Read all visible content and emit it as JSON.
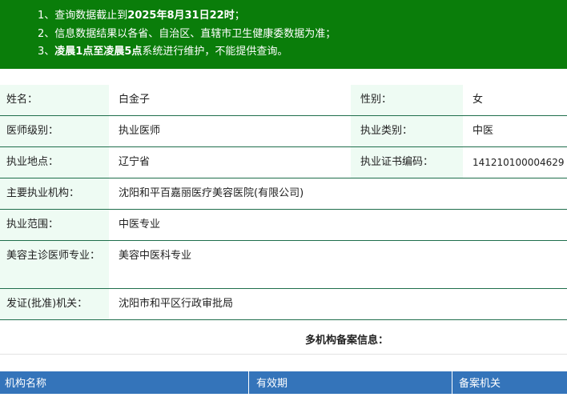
{
  "notice": {
    "line1_prefix": "1、查询数据截止到",
    "line1_bold": "2025年8月31日22时",
    "line1_suffix": "；",
    "line2": "2、信息数据结果以各省、自治区、直辖市卫生健康委数据为准；",
    "line3_prefix": "3、",
    "line3_bold": "凌晨1点至凌晨5点",
    "line3_suffix": "系统进行维护，不能提供查询。",
    "background_color": "#0a7d0a"
  },
  "info": {
    "name_label": "姓名：",
    "name_value": "白金子",
    "gender_label": "性别：",
    "gender_value": "女",
    "level_label": "医师级别：",
    "level_value": "执业医师",
    "category_label": "执业类别：",
    "category_value": "中医",
    "location_label": "执业地点：",
    "location_value": "辽宁省",
    "cert_label": "执业证书编码：",
    "cert_value": "141210100004629",
    "org_label": "主要执业机构：",
    "org_value": "沈阳和平百嘉丽医疗美容医院(有限公司)",
    "scope_label": "执业范围：",
    "scope_value": "中医专业",
    "beauty_label": "美容主诊医师专业：",
    "beauty_value": "美容中医科专业",
    "issuer_label": "发证(批准)机关：",
    "issuer_value": "沈阳市和平区行政审批局"
  },
  "multi_org": {
    "title": "多机构备案信息：",
    "columns": [
      "机构名称",
      "有效期",
      "备案机关"
    ],
    "header_color": "#3474ba"
  }
}
